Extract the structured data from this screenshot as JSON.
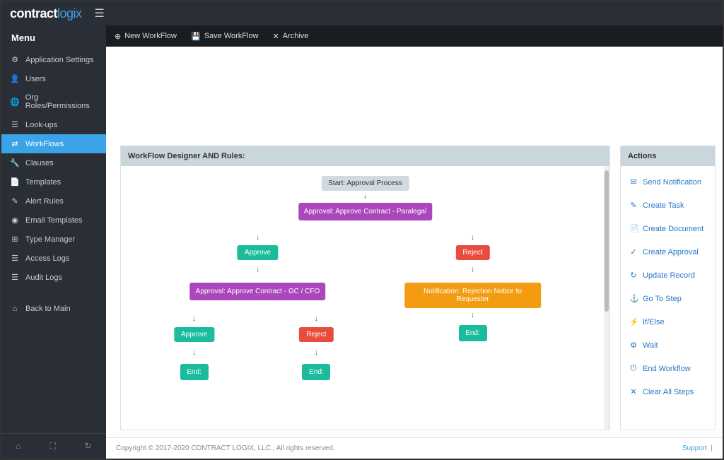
{
  "brand": {
    "part1": "contract",
    "part2": "logix"
  },
  "sidebar": {
    "header": "Menu",
    "items": [
      {
        "icon": "⚙",
        "label": "Application Settings"
      },
      {
        "icon": "👤",
        "label": "Users"
      },
      {
        "icon": "🌐",
        "label": "Org Roles/Permissions"
      },
      {
        "icon": "☰",
        "label": "Look-ups"
      },
      {
        "icon": "⇄",
        "label": "WorkFlows"
      },
      {
        "icon": "🔧",
        "label": "Clauses"
      },
      {
        "icon": "📄",
        "label": "Templates"
      },
      {
        "icon": "✎",
        "label": "Alert Rules"
      },
      {
        "icon": "◉",
        "label": "Email Templates"
      },
      {
        "icon": "⊞",
        "label": "Type Manager"
      },
      {
        "icon": "☰",
        "label": "Access Logs"
      },
      {
        "icon": "☰",
        "label": "Audit Logs"
      }
    ],
    "back": {
      "icon": "⌂",
      "label": "Back to Main"
    }
  },
  "toolbar": {
    "new": "New WorkFlow",
    "save": "Save WorkFlow",
    "archive": "Archive"
  },
  "designer": {
    "title": "WorkFlow Designer AND Rules:",
    "nodes": {
      "start": "Start: Approval Process",
      "approval1": "Approval: Approve Contract - Paralegal",
      "approve1": "Approve",
      "reject1": "Reject",
      "approval2": "Approval: Approve Contract - GC / CFO",
      "notification": "Notification: Rejection Notice to Requester",
      "approve2": "Approve",
      "reject2": "Reject",
      "end1": "End:",
      "end2": "End:",
      "end3": "End:"
    }
  },
  "actions": {
    "title": "Actions",
    "items": [
      {
        "icon": "✉",
        "label": "Send Notification"
      },
      {
        "icon": "✎",
        "label": "Create Task"
      },
      {
        "icon": "📄",
        "label": "Create Document"
      },
      {
        "icon": "✓",
        "label": "Create Approval"
      },
      {
        "icon": "↻",
        "label": "Update Record"
      },
      {
        "icon": "⚓",
        "label": "Go To Step"
      },
      {
        "icon": "⚡",
        "label": "If/Else"
      },
      {
        "icon": "⚙",
        "label": "Wait"
      },
      {
        "icon": "⏻",
        "label": "End Workflow"
      },
      {
        "icon": "✕",
        "label": "Clear All Steps"
      }
    ]
  },
  "footer": {
    "copyright": "Copyright © 2017-2020 CONTRACT LOGIX, LLC., All rights reserved.",
    "support": "Support"
  }
}
